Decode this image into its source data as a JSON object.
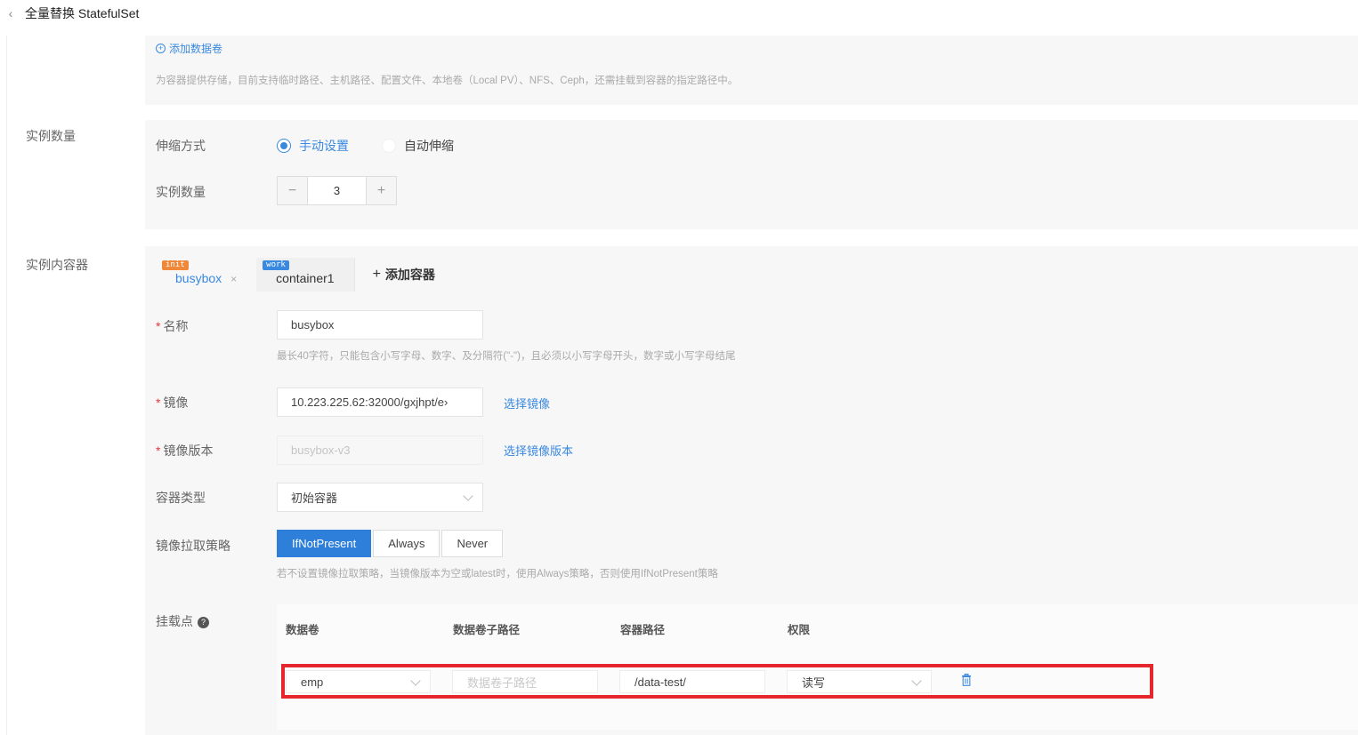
{
  "header": {
    "title": "全量替换 StatefulSet"
  },
  "volumes": {
    "add_label": "添加数据卷",
    "hint": "为容器提供存储，目前支持临时路径、主机路径、配置文件、本地卷（Local PV）、NFS、Ceph，还需挂载到容器的指定路径中。"
  },
  "replicas": {
    "section_label": "实例数量",
    "scaling_label": "伸缩方式",
    "scaling_options": [
      "手动设置",
      "自动伸缩"
    ],
    "count_label": "实例数量",
    "count_value": "3",
    "minus": "−",
    "plus": "+"
  },
  "containers": {
    "section_label": "实例内容器",
    "tabs": [
      {
        "badge": "init",
        "name": "busybox",
        "close": "×"
      },
      {
        "badge": "work",
        "name": "container1"
      }
    ],
    "add_tab": "添加容器",
    "add_plus": "+",
    "name_label": "名称",
    "name_value": "busybox",
    "name_hint": "最长40字符，只能包含小写字母、数字、及分隔符(\"-\")，且必须以小写字母开头，数字或小写字母结尾",
    "image_label": "镜像",
    "image_value": "10.223.225.62:32000/gxjhpt/e›",
    "select_image": "选择镜像",
    "version_label": "镜像版本",
    "version_placeholder": "busybox-v3",
    "select_version": "选择镜像版本",
    "type_label": "容器类型",
    "type_value": "初始容器",
    "pull_label": "镜像拉取策略",
    "pull_options": [
      "IfNotPresent",
      "Always",
      "Never"
    ],
    "pull_hint": "若不设置镜像拉取策略，当镜像版本为空或latest时，使用Always策略，否则使用IfNotPresent策略",
    "mount_label": "挂载点",
    "help": "?",
    "mount_columns": [
      "数据卷",
      "数据卷子路径",
      "容器路径",
      "权限"
    ],
    "mount_row": {
      "volume": "emp",
      "subpath_placeholder": "数据卷子路径",
      "container_path": "/data-test/",
      "permission": "读写"
    }
  },
  "colors": {
    "primary": "#3a89e0",
    "highlight_border": "#e6262d",
    "init_badge": "#f0883a"
  }
}
